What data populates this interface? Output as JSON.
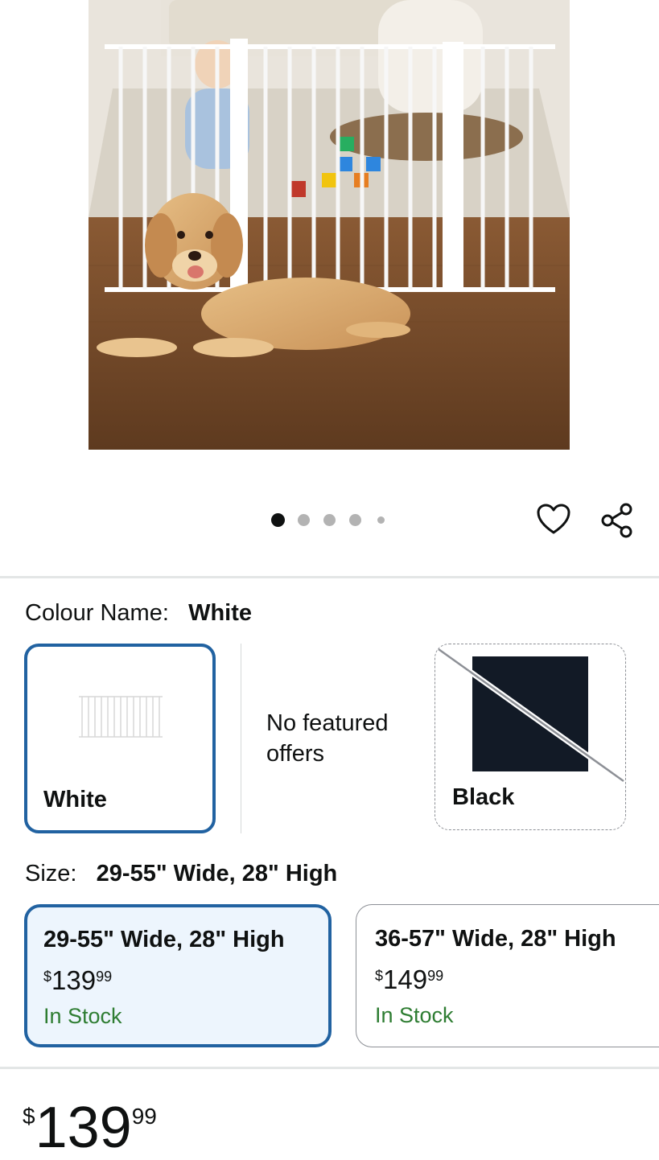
{
  "carousel": {
    "total": 5,
    "active_index": 0
  },
  "icons": {
    "wishlist": "heart-outline-icon",
    "share": "share-icon"
  },
  "colour": {
    "label": "Colour Name:",
    "selected": "White",
    "options": [
      {
        "name": "White",
        "state": "selected"
      },
      {
        "name": "No featured offers",
        "state": "info"
      },
      {
        "name": "Black",
        "state": "unavailable"
      }
    ]
  },
  "size": {
    "label": "Size:",
    "selected": "29-55\" Wide, 28\" High",
    "options": [
      {
        "title": "29-55\" Wide, 28\" High",
        "currency": "$",
        "price_whole": "139",
        "price_frac": "99",
        "stock": "In Stock",
        "state": "selected"
      },
      {
        "title": "36-57\" Wide, 28\" High",
        "currency": "$",
        "price_whole": "149",
        "price_frac": "99",
        "stock": "In Stock",
        "state": "normal"
      }
    ]
  },
  "price": {
    "currency": "$",
    "whole": "139",
    "fraction": "99"
  },
  "colors": {
    "accent": "#2162a1",
    "in_stock": "#2e7d32",
    "selected_bg": "#edf5fd"
  }
}
